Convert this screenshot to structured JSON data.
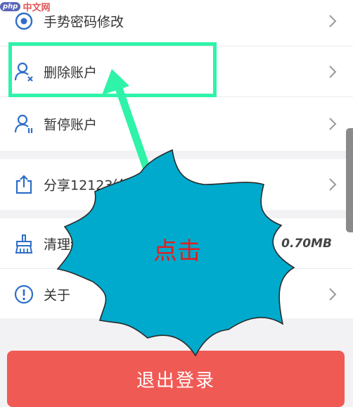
{
  "watermark": {
    "badge": "php",
    "text": "中文网"
  },
  "settings": {
    "items": [
      {
        "label": "手势密码修改",
        "icon": "target-icon"
      },
      {
        "label": "删除账户",
        "icon": "user-delete-icon"
      },
      {
        "label": "暂停账户",
        "icon": "user-pause-icon"
      },
      {
        "label": "分享12123给好友",
        "icon": "share-icon"
      },
      {
        "label": "清理缓存",
        "icon": "broom-icon",
        "value": "0.70MB"
      },
      {
        "label": "关于",
        "icon": "info-icon"
      }
    ]
  },
  "logout": {
    "label": "退出登录"
  },
  "annotation": {
    "callout_text": "点击"
  },
  "colors": {
    "accent_blue": "#2e6ec8",
    "highlight_green": "#2ef3a8",
    "burst_fill": "#00aacc",
    "callout_text": "#e02020",
    "logout_red": "#f05a55"
  }
}
